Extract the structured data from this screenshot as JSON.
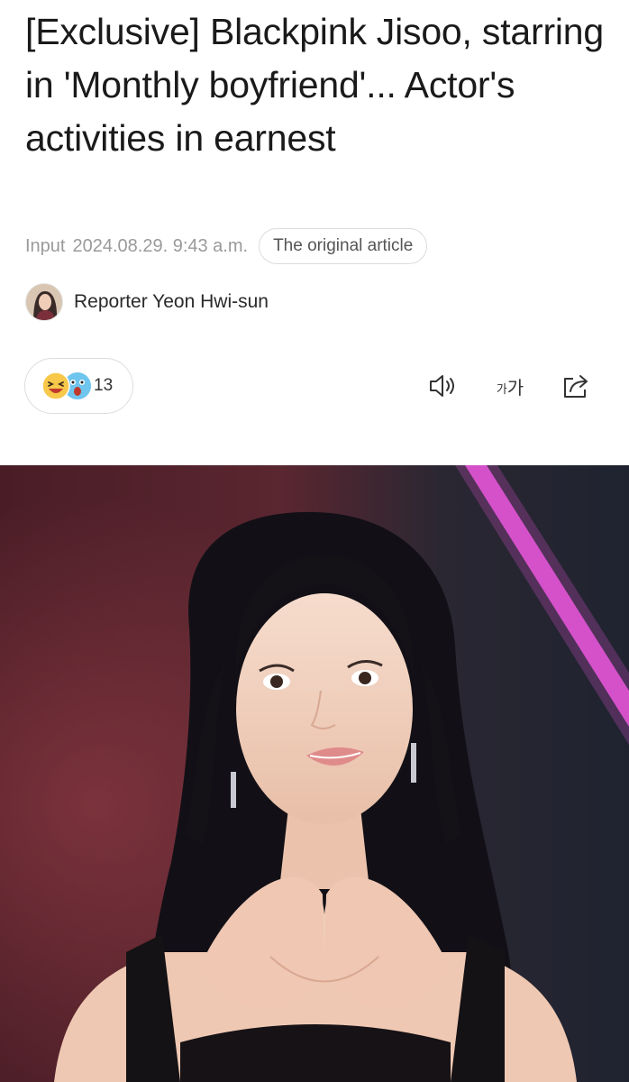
{
  "article": {
    "headline": "[Exclusive] Blackpink Jisoo, starring in 'Monthly boyfriend'... Actor's activities in earnest",
    "input_label": "Input",
    "input_datetime": "2024.08.29. 9:43 a.m.",
    "original_article_label": "The original article",
    "reporter": "Reporter Yeon Hwi-sun"
  },
  "reactions": {
    "count": "13",
    "icons": [
      "laughing-emoji-icon",
      "surprised-emoji-icon"
    ]
  },
  "toolbar": {
    "icons": [
      "speaker-icon",
      "font-size-icon",
      "share-icon"
    ],
    "font_size_small": "가",
    "font_size_large": "가"
  },
  "colors": {
    "text": "#1a1a1a",
    "muted": "#9a9a9a",
    "border": "#dddddd",
    "emoji_yellow": "#f7c84a",
    "emoji_blue": "#6ec5ee",
    "stage_pink": "#e255d6"
  }
}
